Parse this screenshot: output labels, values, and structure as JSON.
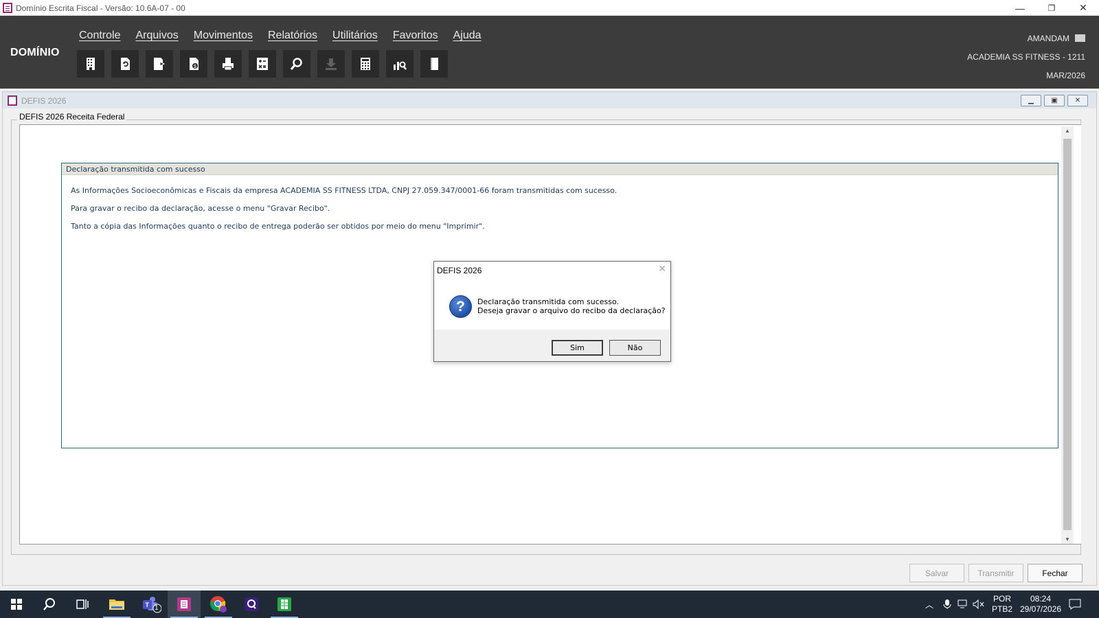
{
  "window": {
    "title": "Domínio Escrita Fiscal  - Versão: 10.6A-07 - 00",
    "minimize_glyph": "—",
    "restore_glyph": "❐",
    "close_glyph": "✕"
  },
  "header": {
    "brand": "DOMÍNIO",
    "menu": [
      "Controle",
      "Arquivos",
      "Movimentos",
      "Relatórios",
      "Utilitários",
      "Favoritos",
      "Ajuda"
    ],
    "user": "AMANDAM",
    "company": "ACADEMIA SS FITNESS  - 1211",
    "period": "MAR/2026",
    "toolbar_icons": [
      "building-icon",
      "refresh-document-icon",
      "document-export-icon",
      "document-money-icon",
      "printer-icon",
      "calculator-sheet-icon",
      "search-icon",
      "download-icon",
      "calculator-icon",
      "chart-search-icon",
      "book-icon"
    ]
  },
  "child_window": {
    "title": "DEFIS 2026",
    "group_label": "DEFIS 2026 Receita Federal",
    "message_header": "Declaração transmitida com sucesso",
    "lines": [
      "As Informações Socioeconômicas e Fiscais da empresa ACADEMIA SS FITNESS LTDA, CNPJ 27.059.347/0001-66 foram transmitidas com sucesso.",
      "Para gravar o recibo da declaração, acesse o menu \"Gravar Recibo\".",
      "Tanto a cópia das Informações quanto o recibo de entrega poderão ser obtidos por meio do menu \"Imprimir\"."
    ],
    "buttons": {
      "save": "Salvar",
      "transmit": "Transmitir",
      "close": "Fechar"
    }
  },
  "dialog": {
    "title": "DEFIS 2026",
    "line1": "Declaração transmitida com sucesso.",
    "line2": "Deseja gravar o arquivo do recibo da declaração?",
    "yes": "Sim",
    "no": "Não",
    "icon": "?"
  },
  "taskbar": {
    "teams_badge": "1",
    "lang1": "POR",
    "lang2": "PTB2",
    "time": "08:24",
    "date": "29/07/2026"
  }
}
